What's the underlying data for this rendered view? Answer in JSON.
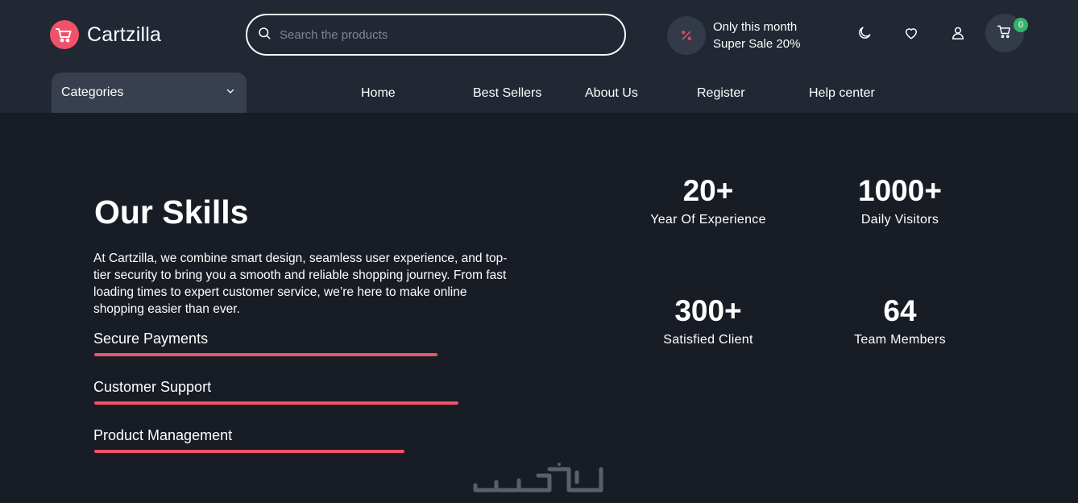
{
  "header": {
    "logo_text": "Cartzilla",
    "search": {
      "placeholder": "Search the products",
      "value": ""
    },
    "promo": {
      "line1": "Only this month",
      "line2": "Super Sale 20%",
      "icon": "percent-icon"
    },
    "icons": [
      "moon-icon",
      "heart-icon",
      "user-icon",
      "cart-icon"
    ],
    "cart_count": "0"
  },
  "nav": {
    "categories_label": "Categories",
    "links": [
      "Home",
      "Best Sellers",
      "About Us",
      "Register",
      "Help center"
    ]
  },
  "skills": {
    "title": "Our Skills",
    "description": "At Cartzilla, we combine smart design, seamless user experience, and top-tier security to bring you a smooth and reliable shopping journey. From fast loading times to expert customer service, we’re here to make online shopping easier than ever.",
    "items": [
      {
        "label": "Secure Payments",
        "level": 0.82
      },
      {
        "label": "Customer Support",
        "level": 0.87
      },
      {
        "label": "Product Management",
        "level": 0.74
      }
    ]
  },
  "stats": [
    {
      "number": "20+",
      "label": "Year Of Experience"
    },
    {
      "number": "1000+",
      "label": "Daily Visitors"
    },
    {
      "number": "300+",
      "label": "Satisfied Client"
    },
    {
      "number": "64",
      "label": "Team Members"
    }
  ],
  "colors": {
    "accent": "#f0526a",
    "header_bg": "#222734",
    "page_bg": "#181c25",
    "badge_green": "#35b36b"
  }
}
